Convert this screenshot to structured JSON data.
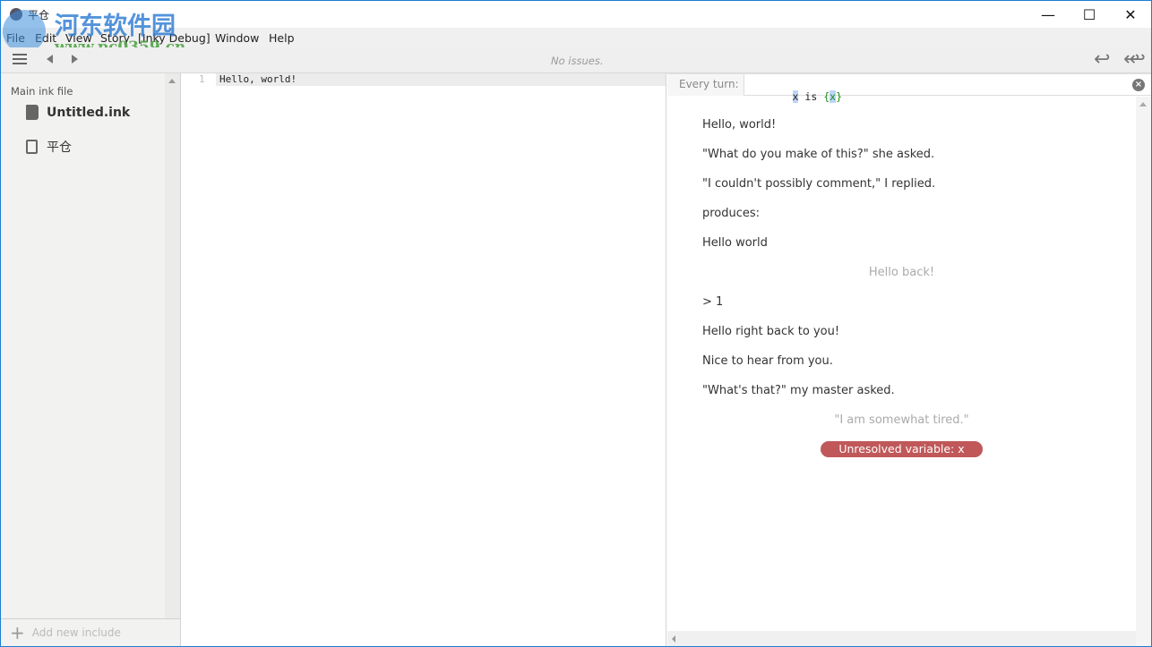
{
  "window": {
    "title": "平仓",
    "minimize": "—",
    "maximize": "☐",
    "close": "✕"
  },
  "watermark": {
    "name": "河东软件园",
    "url": "www.pc0359.cn"
  },
  "menu": [
    "File",
    "Edit",
    "View",
    "Story",
    "[Inky Debug]",
    "Window",
    "Help"
  ],
  "toolbar": {
    "status": "No issues.",
    "menu_icon": "hamburger-icon",
    "back_icon": "triangle-left",
    "forward_icon": "triangle-right",
    "rewind_icon": "reply",
    "rewind_all_icon": "reply-all"
  },
  "sidebar": {
    "section_label": "Main ink file",
    "files": [
      {
        "name": "Untitled.ink",
        "icon": "book-icon"
      },
      {
        "name": "平仓",
        "icon": "document-icon"
      }
    ],
    "add_include": "Add new include"
  },
  "editor": {
    "lines": [
      {
        "number": "1",
        "text": "Hello, world!"
      }
    ]
  },
  "player": {
    "every_turn_label": "Every turn:",
    "expression": {
      "part1": "x",
      "part2": " is ",
      "part3": "{",
      "part4": "x",
      "part5": "}"
    },
    "output": [
      {
        "text": "Hello, world!",
        "kind": "text"
      },
      {
        "text": "\"What do you make of this?\" she asked.",
        "kind": "text"
      },
      {
        "text": "\"I couldn't possibly comment,\" I replied.",
        "kind": "text"
      },
      {
        "text": "produces:",
        "kind": "text"
      },
      {
        "text": "Hello world",
        "kind": "text"
      },
      {
        "text": "Hello back!",
        "kind": "choice"
      },
      {
        "text": "> 1",
        "kind": "text"
      },
      {
        "text": "Hello right back to you!",
        "kind": "text"
      },
      {
        "text": "Nice to hear from you.",
        "kind": "text"
      },
      {
        "text": "\"What's that?\" my master asked.",
        "kind": "text"
      },
      {
        "text": "\"I am somewhat tired.\"",
        "kind": "choice"
      }
    ],
    "error": "Unresolved variable: x",
    "error_color": "#c0585a"
  }
}
